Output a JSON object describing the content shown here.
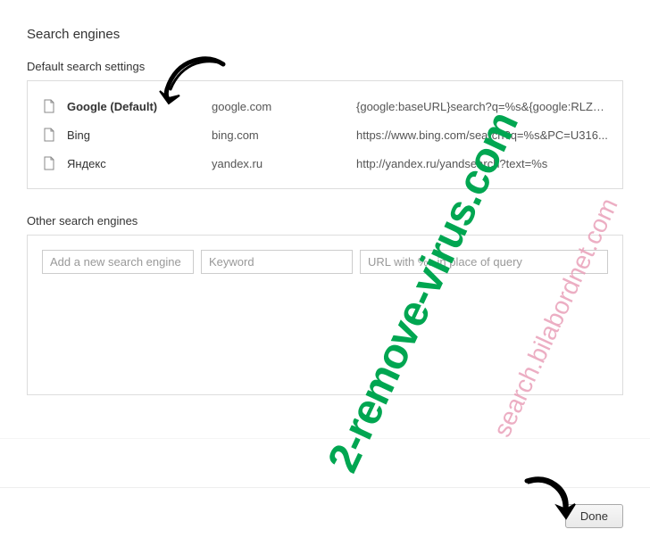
{
  "pageTitle": "Search engines",
  "defaultSection": {
    "title": "Default search settings",
    "engines": [
      {
        "name": "Google (Default)",
        "keyword": "google.com",
        "url": "{google:baseURL}search?q=%s&{google:RLZ}{g...",
        "isDefault": true
      },
      {
        "name": "Bing",
        "keyword": "bing.com",
        "url": "https://www.bing.com/search?q=%s&PC=U316...",
        "isDefault": false
      },
      {
        "name": "Яндекс",
        "keyword": "yandex.ru",
        "url": "http://yandex.ru/yandsearch?text=%s",
        "isDefault": false
      }
    ]
  },
  "otherSection": {
    "title": "Other search engines",
    "placeholders": {
      "name": "Add a new search engine",
      "keyword": "Keyword",
      "url": "URL with %s in place of query"
    }
  },
  "footer": {
    "doneLabel": "Done"
  },
  "watermarks": {
    "green": "2-remove-virus.com",
    "pink": "search.bilabordnet.com"
  }
}
